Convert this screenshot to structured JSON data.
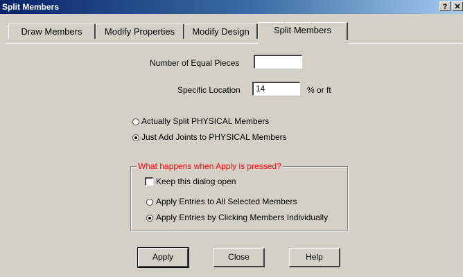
{
  "window": {
    "title": "Split Members",
    "help_button": "?",
    "close_button": "✕"
  },
  "tabs": [
    {
      "label": "Draw Members",
      "active": false
    },
    {
      "label": "Modify Properties",
      "active": false
    },
    {
      "label": "Modify Design",
      "active": false
    },
    {
      "label": "Split Members",
      "active": true
    }
  ],
  "form": {
    "equal_pieces_label": "Number of Equal Pieces",
    "equal_pieces_value": "",
    "specific_location_label": "Specific Location",
    "specific_location_value": "14",
    "specific_location_unit": "% or ft"
  },
  "split_mode": {
    "options": [
      {
        "label": "Actually Split PHYSICAL Members",
        "selected": false
      },
      {
        "label": "Just Add Joints to PHYSICAL Members",
        "selected": true
      }
    ]
  },
  "apply_group": {
    "title": "What happens when Apply is pressed?",
    "keep_open_label": "Keep this dialog open",
    "keep_open_checked": false,
    "options": [
      {
        "label": "Apply Entries to All Selected Members",
        "selected": false
      },
      {
        "label": "Apply Entries by Clicking Members Individually",
        "selected": true
      }
    ],
    "accent_color": "#ff0000"
  },
  "buttons": {
    "apply": "Apply",
    "close": "Close",
    "help": "Help"
  }
}
